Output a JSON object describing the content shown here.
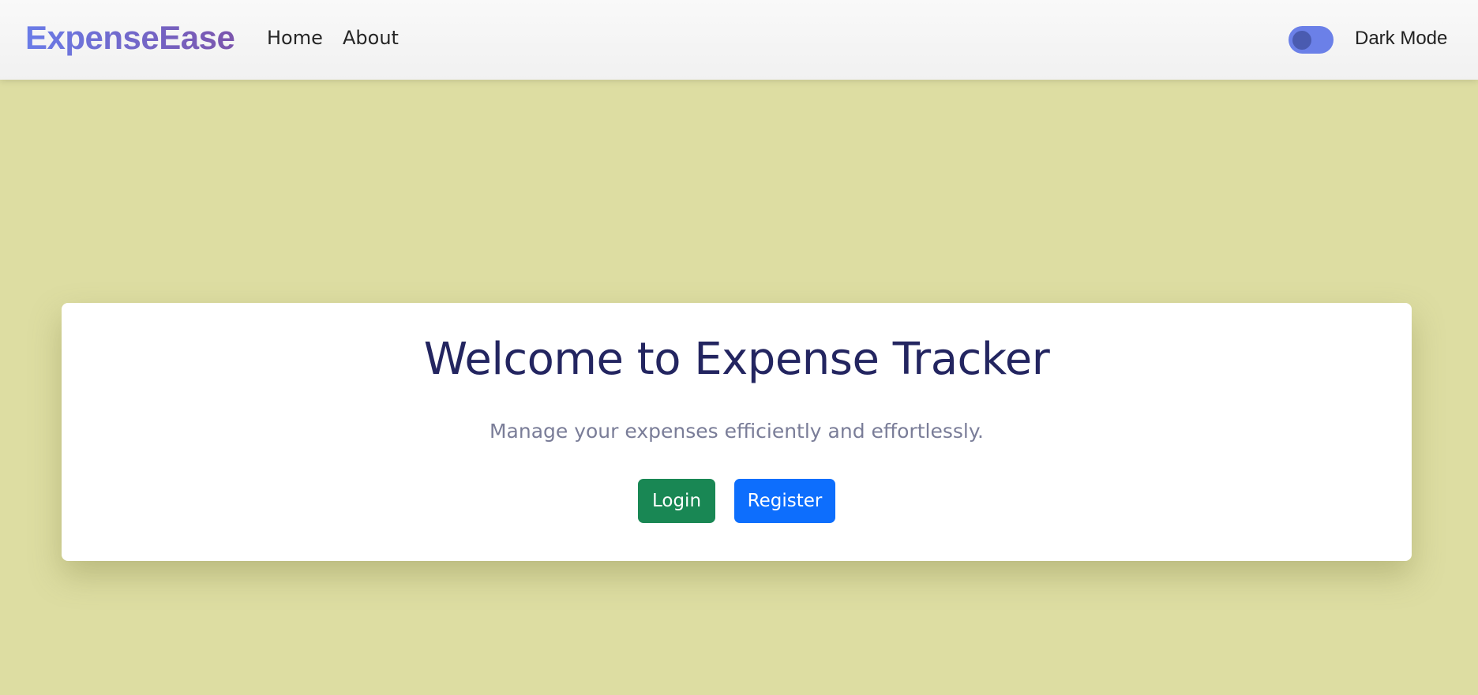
{
  "navbar": {
    "brand": "ExpenseEase",
    "links": [
      {
        "label": "Home"
      },
      {
        "label": "About"
      }
    ],
    "dark_mode_label": "Dark Mode",
    "dark_mode_enabled": false
  },
  "hero": {
    "title": "Welcome to Expense Tracker",
    "subtitle": "Manage your expenses efficiently and effortlessly.",
    "login_label": "Login",
    "register_label": "Register"
  },
  "colors": {
    "background": "#dddda2",
    "brand_gradient_start": "#6a7ce8",
    "brand_gradient_end": "#7b55ad",
    "login_button": "#198754",
    "register_button": "#0d6efd",
    "toggle": "#6b80e8",
    "title": "#232560"
  }
}
